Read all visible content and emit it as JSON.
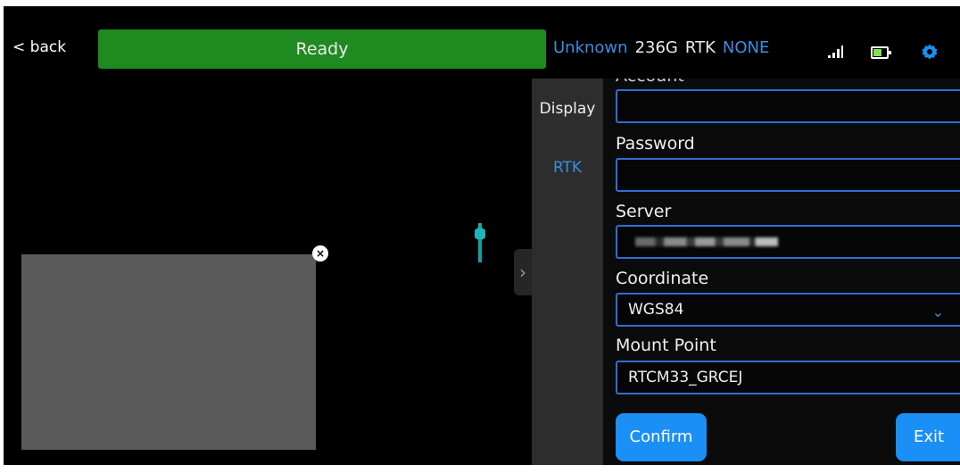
{
  "header": {
    "back_label": "< back",
    "status": "Ready",
    "status_color": "#1f8a1f",
    "device_state": "Unknown",
    "storage": "236G",
    "rtk_label": "RTK",
    "rtk_status": "NONE"
  },
  "icons": [
    "signal-icon",
    "battery-icon",
    "gear-icon",
    "close-icon",
    "drone-icon",
    "chevron-right-icon",
    "chevron-down-icon"
  ],
  "accent_color": "#1a8ff5",
  "side_nav": {
    "items": [
      {
        "label": "Display",
        "active": false
      },
      {
        "label": "RTK",
        "active": true
      }
    ]
  },
  "rtk_form": {
    "account_label": "Account",
    "account_value": "",
    "password_label": "Password",
    "password_value": "",
    "server_label": "Server",
    "coordinate_label": "Coordinate",
    "coordinate_value": "WGS84",
    "mount_point_label": "Mount Point",
    "mount_point_value": "RTCM33_GRCEJ",
    "confirm_label": "Confirm",
    "exit_label": "Exit"
  },
  "collapse_glyph": "›",
  "close_glyph": "×"
}
